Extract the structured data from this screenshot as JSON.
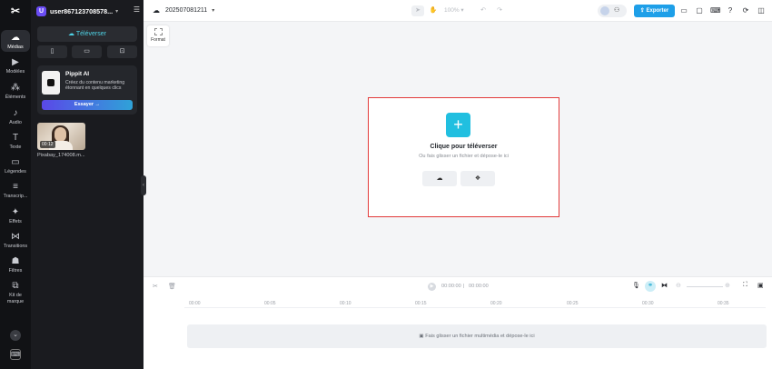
{
  "rail": {
    "items": [
      {
        "label": "Médias",
        "icon": "☁",
        "active": true
      },
      {
        "label": "Modèles",
        "icon": "▶"
      },
      {
        "label": "Éléments",
        "icon": "⁂"
      },
      {
        "label": "Audio",
        "icon": "♪"
      },
      {
        "label": "Texte",
        "icon": "T"
      },
      {
        "label": "Légendes",
        "icon": "▭"
      },
      {
        "label": "Transcrip...",
        "icon": "≡"
      },
      {
        "label": "Effets",
        "icon": "✦"
      },
      {
        "label": "Transitions",
        "icon": "⋈"
      },
      {
        "label": "Filtres",
        "icon": "☗"
      },
      {
        "label": "Kit de marque",
        "icon": "⧉"
      }
    ]
  },
  "panel": {
    "avatar_letter": "U",
    "username": "user867123708578...",
    "upload_label": "Téléverser",
    "promo": {
      "title": "Pippit AI",
      "text": "Créez du contenu marketing étonnant en quelques clics",
      "button": "Essayer →"
    },
    "media": {
      "duration": "00:12",
      "name": "Pixabay_174008.m..."
    }
  },
  "topbar": {
    "project_name": "202507081211",
    "zoom": "100%",
    "export_label": "Exporter"
  },
  "canvas": {
    "format_label": "Format",
    "drop_title": "Clique pour téléverser",
    "drop_subtitle": "Ou fais glisser un fichier et dépose-le ici"
  },
  "timeline": {
    "current_time": "00:00:00",
    "total_time": "00:00:00",
    "ticks": [
      "00:00",
      "00:05",
      "00:10",
      "00:15",
      "00:20",
      "00:25",
      "00:30",
      "00:35"
    ],
    "drop_hint": "Fais glisser un fichier multimédia et dépose-le ici"
  }
}
